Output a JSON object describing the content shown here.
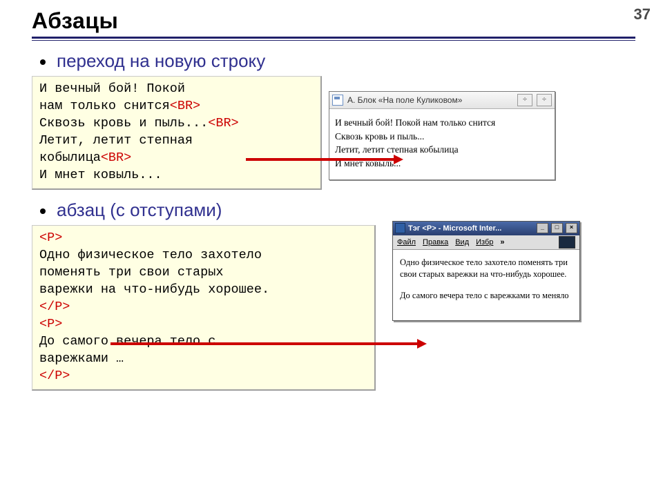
{
  "page": {
    "num": "37",
    "title": "Абзацы"
  },
  "bullets": [
    "переход на новую строку",
    "абзац (с отступами)"
  ],
  "code1": {
    "plain": [
      "И вечный бой! Покой",
      "нам только снится",
      "Сквозь кровь и пыль...",
      "Летит, летит степная",
      "кобылица",
      "И мнет ковыль..."
    ],
    "br_tag": "<BR>",
    "br_after_lines": [
      1,
      2,
      4
    ]
  },
  "code2": {
    "plain": [
      "Одно физическое тело захотело",
      "поменять три свои старых",
      "варежки на что-нибудь хорошее.",
      "До самого вечера тело с",
      "варежками …"
    ],
    "open_tag": "<P>",
    "close_tag": "</P>"
  },
  "previews": [
    {
      "title": "А. Блок  «На поле Куликовом»",
      "lines": [
        "И вечный бой! Покой нам только снится",
        "Сквозь кровь и пыль...",
        "Летит, летит степная кобылица",
        "И мнет ковыль..."
      ]
    },
    {
      "title": "Тэг <P> - Microsoft Inter...",
      "menu": [
        "Файл",
        "Правка",
        "Вид",
        "Избр",
        "»"
      ],
      "paras": [
        "Одно физическое тело захотело поменять три свои старых варежки на что-нибудь хорошее.",
        "До самого вечера тело с варежками то меняло"
      ]
    }
  ]
}
